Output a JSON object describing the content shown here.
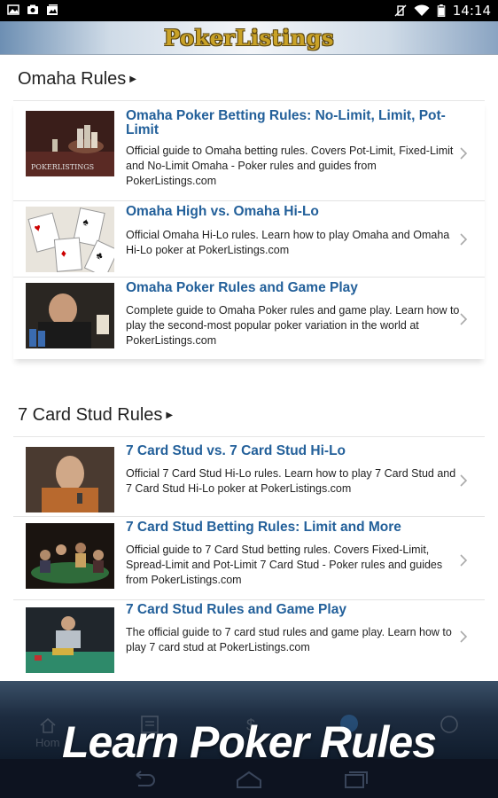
{
  "status_bar": {
    "time": "14:14"
  },
  "app": {
    "logo_text": "PokerListings"
  },
  "sections": [
    {
      "title": "Omaha Rules",
      "items": [
        {
          "title": "Omaha Poker Betting Rules: No-Limit, Limit, Pot-Limit",
          "description": "Official guide to Omaha betting rules. Covers Pot-Limit, Fixed-Limit and No-Limit Omaha - Poker rules and guides from PokerListings.com",
          "thumb_caption": "POKERLISTINGS"
        },
        {
          "title": "Omaha High vs. Omaha Hi-Lo",
          "description": "Official Omaha Hi-Lo rules. Learn how to play Omaha and Omaha Hi-Lo poker at PokerListings.com"
        },
        {
          "title": "Omaha Poker Rules and Game Play",
          "description": "Complete guide to Omaha Poker rules and game play. Learn how to play the second-most popular poker variation in the world at PokerListings.com"
        }
      ]
    },
    {
      "title": "7 Card Stud Rules",
      "items": [
        {
          "title": "7 Card Stud vs. 7 Card Stud Hi-Lo",
          "description": "Official 7 Card Stud Hi-Lo rules. Learn how to play 7 Card Stud and 7 Card Stud Hi-Lo poker at PokerListings.com"
        },
        {
          "title": "7 Card Stud Betting Rules: Limit and More",
          "description": "Official guide to 7 Card Stud betting rules. Covers Fixed-Limit, Spread-Limit and Pot-Limit 7 Card Stud - Poker rules and guides from PokerListings.com"
        },
        {
          "title": "7 Card Stud Rules and Game Play",
          "description": "The official guide to 7 card stud rules and game play. Learn how to play 7 card stud at PokerListings.com"
        }
      ]
    }
  ],
  "banner": {
    "text": "Learn Poker Rules"
  },
  "bottom_nav": {
    "home_label": "Hom"
  },
  "colors": {
    "link": "#23609a",
    "header_gold": "#c9a227",
    "banner_dark": "#101c2c"
  }
}
